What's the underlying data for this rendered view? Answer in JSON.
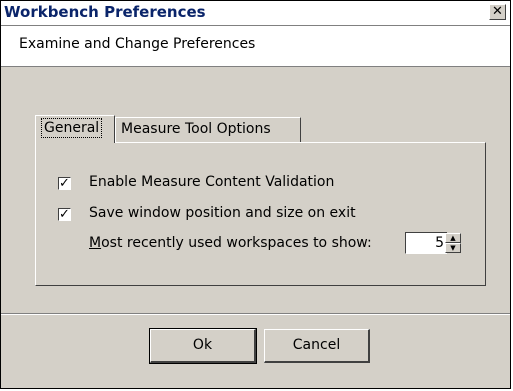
{
  "window": {
    "title": "Workbench Preferences",
    "close_glyph": "✕",
    "subtitle": "Examine and Change Preferences"
  },
  "tabs": [
    {
      "label": "General",
      "selected": true
    },
    {
      "label": "Measure Tool Options",
      "selected": false
    }
  ],
  "general": {
    "options": [
      {
        "label": "Enable Measure Content Validation",
        "checked": true
      },
      {
        "label": "Save window position and size on exit",
        "checked": true
      }
    ],
    "mru_label_first": "M",
    "mru_label_rest": "ost recently used workspaces to show:",
    "mru_value": "5"
  },
  "buttons": {
    "ok": "Ok",
    "cancel": "Cancel"
  },
  "checkmark": "✓"
}
